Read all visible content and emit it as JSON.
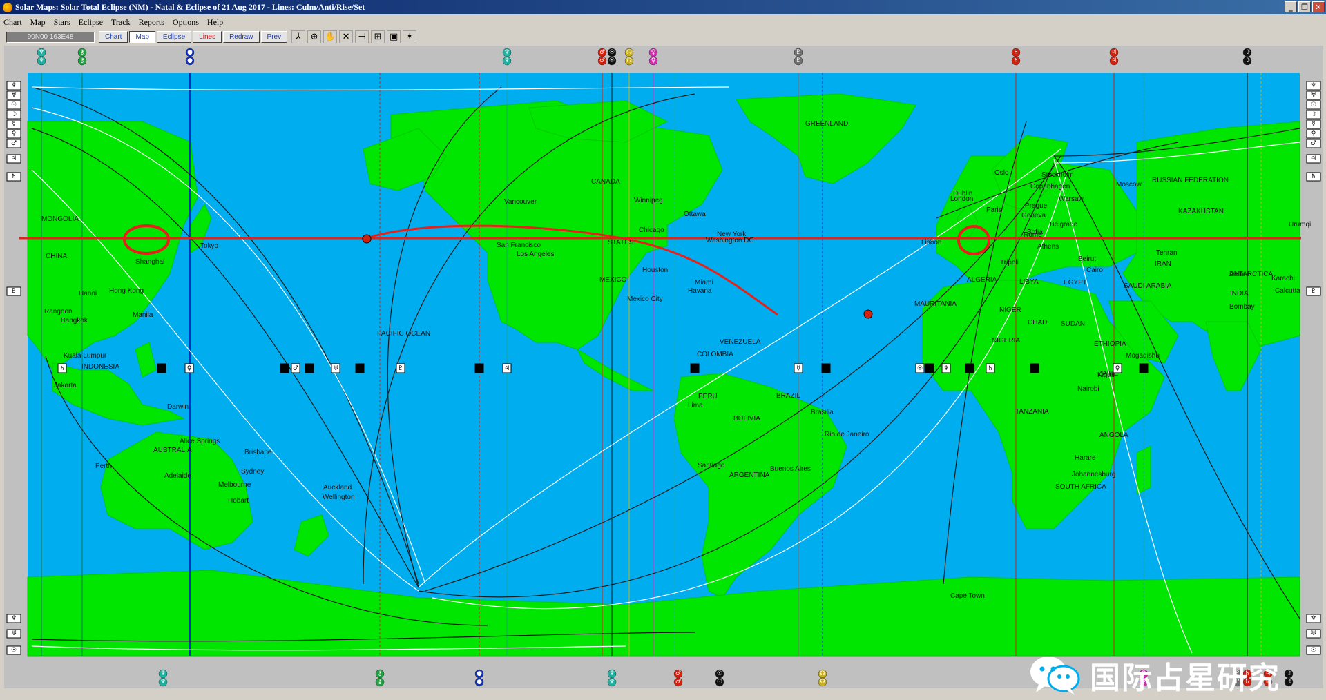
{
  "window": {
    "title": "Solar Maps: Solar Total Eclipse (NM) - Natal  & Eclipse of 21 Aug 2017 - Lines: Culm/Anti/Rise/Set",
    "buttons": [
      "_",
      "❐",
      "✕"
    ]
  },
  "menu": [
    "Chart",
    "Map",
    "Stars",
    "Eclipse",
    "Track",
    "Reports",
    "Options",
    "Help"
  ],
  "toolbar": {
    "coords": "90N00 163E48",
    "buttons": [
      {
        "label": "Chart",
        "active": false,
        "color": "blue"
      },
      {
        "label": "Map",
        "active": true,
        "color": "blue"
      },
      {
        "label": "Eclipse",
        "active": false,
        "color": "blue"
      },
      {
        "label": "Lines",
        "active": false,
        "color": "red"
      },
      {
        "label": "Redraw",
        "active": false,
        "color": "blue"
      },
      {
        "label": "Prev",
        "active": false,
        "color": "blue"
      }
    ],
    "tool_icons": [
      "cursor-tool-icon",
      "zoom-tool-icon",
      "pan-tool-icon",
      "cross-tool-icon",
      "marker-tool-icon",
      "grid-tool-icon",
      "note-tool-icon",
      "axes-tool-icon"
    ],
    "tool_glyphs": [
      "⅄",
      "⊕",
      "✋",
      "✕",
      "⊣",
      "⊞",
      "▣",
      "✶"
    ]
  },
  "colors": {
    "ocean": "#00aeef",
    "land": "#00e600",
    "eclipse_path": "#e8201a",
    "frame": "#c0c0c0"
  },
  "cities": [
    {
      "name": "GREENLAND"
    },
    {
      "name": "CANADA"
    },
    {
      "name": "Vancouver"
    },
    {
      "name": "Winnipeg"
    },
    {
      "name": "Ottawa"
    },
    {
      "name": "Chicago"
    },
    {
      "name": "New York"
    },
    {
      "name": "Washington DC"
    },
    {
      "name": "STATES"
    },
    {
      "name": "San Francisco"
    },
    {
      "name": "Los Angeles"
    },
    {
      "name": "Houston"
    },
    {
      "name": "Miami"
    },
    {
      "name": "Havana"
    },
    {
      "name": "MEXICO"
    },
    {
      "name": "Mexico City"
    },
    {
      "name": "VENEZUELA"
    },
    {
      "name": "COLOMBIA"
    },
    {
      "name": "PERU"
    },
    {
      "name": "Lima"
    },
    {
      "name": "BRAZIL"
    },
    {
      "name": "BOLIVIA"
    },
    {
      "name": "Brasilia"
    },
    {
      "name": "Rio de Janeiro"
    },
    {
      "name": "Santiago"
    },
    {
      "name": "ARGENTINA"
    },
    {
      "name": "Buenos Aires"
    },
    {
      "name": "PACIFIC OCEAN"
    },
    {
      "name": "MONGOLIA"
    },
    {
      "name": "CHINA"
    },
    {
      "name": "Tokyo"
    },
    {
      "name": "Shanghai"
    },
    {
      "name": "Hanoi"
    },
    {
      "name": "Hong Kong"
    },
    {
      "name": "Rangoon"
    },
    {
      "name": "Bangkok"
    },
    {
      "name": "Manila"
    },
    {
      "name": "Kuala Lumpur"
    },
    {
      "name": "INDONESIA"
    },
    {
      "name": "Jakarta"
    },
    {
      "name": "Darwin"
    },
    {
      "name": "Alice Springs"
    },
    {
      "name": "AUSTRALIA"
    },
    {
      "name": "Brisbane"
    },
    {
      "name": "Perth"
    },
    {
      "name": "Adelaide"
    },
    {
      "name": "Sydney"
    },
    {
      "name": "Melbourne"
    },
    {
      "name": "Hobart"
    },
    {
      "name": "Auckland"
    },
    {
      "name": "Wellington"
    },
    {
      "name": "Oslo"
    },
    {
      "name": "Stockholm"
    },
    {
      "name": "Copenhagen"
    },
    {
      "name": "Warsaw"
    },
    {
      "name": "Moscow"
    },
    {
      "name": "RUSSIAN FEDERATION"
    },
    {
      "name": "Dublin"
    },
    {
      "name": "London"
    },
    {
      "name": "Paris"
    },
    {
      "name": "Geneva"
    },
    {
      "name": "Prague"
    },
    {
      "name": "Belgrade"
    },
    {
      "name": "Sofia"
    },
    {
      "name": "Rome"
    },
    {
      "name": "Athens"
    },
    {
      "name": "KAZAKHSTAN"
    },
    {
      "name": "Lisbon"
    },
    {
      "name": "Beirut"
    },
    {
      "name": "Cairo"
    },
    {
      "name": "Tehran"
    },
    {
      "name": "IRAN"
    },
    {
      "name": "Urumqi"
    },
    {
      "name": "Tripoli"
    },
    {
      "name": "ALGERIA"
    },
    {
      "name": "LIBYA"
    },
    {
      "name": "EGYPT"
    },
    {
      "name": "SAUDI ARABIA"
    },
    {
      "name": "Delhi"
    },
    {
      "name": "INDIA"
    },
    {
      "name": "Bombay"
    },
    {
      "name": "Karachi"
    },
    {
      "name": "Calcutta"
    },
    {
      "name": "MAURITANIA"
    },
    {
      "name": "NIGER"
    },
    {
      "name": "CHAD"
    },
    {
      "name": "SUDAN"
    },
    {
      "name": "ETHIOPIA"
    },
    {
      "name": "NIGERIA"
    },
    {
      "name": "Mogadishu"
    },
    {
      "name": "ZAIRE"
    },
    {
      "name": "Kigali"
    },
    {
      "name": "Nairobi"
    },
    {
      "name": "TANZANIA"
    },
    {
      "name": "ANGOLA"
    },
    {
      "name": "Harare"
    },
    {
      "name": "Johannesburg"
    },
    {
      "name": "SOUTH AFRICA"
    },
    {
      "name": "Cape Town"
    },
    {
      "name": "ANTARCTICA"
    },
    {
      "name": "Delhi"
    }
  ],
  "planet_lines": [
    {
      "glyph": "♆",
      "color": "#20b0a0"
    },
    {
      "glyph": "⚷",
      "color": "#20a040"
    },
    {
      "glyph": "●",
      "color": "#1030c0"
    },
    {
      "glyph": "♆",
      "color": "#20b0a0"
    },
    {
      "glyph": "♂",
      "color": "#d02010"
    },
    {
      "glyph": "☉",
      "color": "#111111"
    },
    {
      "glyph": "☊",
      "color": "#c8b020"
    },
    {
      "glyph": "♀",
      "color": "#d030b0"
    },
    {
      "glyph": "♇",
      "color": "#707070"
    },
    {
      "glyph": "♄",
      "color": "#d02010"
    },
    {
      "glyph": "♃",
      "color": "#d02010"
    },
    {
      "glyph": "☽",
      "color": "#111111"
    }
  ],
  "eclipse_labels": [
    "♄",
    "♃",
    "♀",
    "☿",
    "♂",
    "☉",
    "♅",
    "♆",
    "♇"
  ],
  "side_glyphs": [
    "♆",
    "♅",
    "☉",
    "☽",
    "☿",
    "♀",
    "♂",
    "♃",
    "♄",
    "♇"
  ],
  "watermark": {
    "text": "国际占星研究",
    "icon": "wechat-icon"
  }
}
